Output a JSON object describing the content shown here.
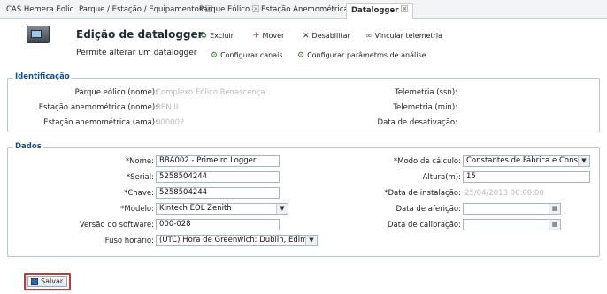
{
  "tabs": [
    {
      "label": "CAS Hemera Eolic",
      "closable": false
    },
    {
      "label": "Parque / Estação / Equipamentos",
      "closable": true
    },
    {
      "label": "Parque Eólico",
      "closable": true
    },
    {
      "label": "Estação Anemométrica",
      "closable": true
    },
    {
      "label": "Datalogger",
      "closable": true,
      "active": true
    }
  ],
  "header": {
    "title": "Edição de datalogger",
    "subtitle": "Permite alterar um datalogger",
    "actions": {
      "excluir": "Excluir",
      "mover": "Mover",
      "desabilitar": "Desabilitar",
      "vincular": "Vincular telemetria",
      "configurar_canais": "Configurar canais",
      "configurar_parametros": "Configurar parâmetros de análise"
    }
  },
  "identificacao": {
    "legend": "Identificação",
    "parque_label": "Parque eólico (nome):",
    "parque_value": "Complexo Eólico Renascença",
    "estacao_nome_label": "Estação anemométrica (nome):",
    "estacao_nome_value": "REN II",
    "estacao_ama_label": "Estação anemométrica (ama):",
    "estacao_ama_value": "000002",
    "telemetria_ssn_label": "Telemetria (ssn):",
    "telemetria_min_label": "Telemetria (min):",
    "data_desativacao_label": "Data de desativação:"
  },
  "dados": {
    "legend": "Dados",
    "nome_label": "*Nome:",
    "nome_value": "BBA002 - Primeiro Logger",
    "serial_label": "*Serial:",
    "serial_value": "5258504244",
    "chave_label": "*Chave:",
    "chave_value": "5258504244",
    "modelo_label": "*Modelo:",
    "modelo_value": "Kintech EOL Zenith",
    "versao_label": "Versão do software:",
    "versao_value": "000-028",
    "fuso_label": "Fuso horário:",
    "fuso_value": "(UTC) Hora de Greenwich: Dublin, Edimbu",
    "modo_label": "*Modo de cálculo:",
    "modo_value": "Constantes de Fábrica e Constan",
    "altura_label": "Altura(m):",
    "altura_value": "15",
    "data_instalacao_label": "*Data de instalação:",
    "data_instalacao_value": "25/04/2013 00:00:00",
    "data_afericao_label": "Data de aferição:",
    "data_calibracao_label": "Data de calibração:"
  },
  "save_label": "Salvar"
}
